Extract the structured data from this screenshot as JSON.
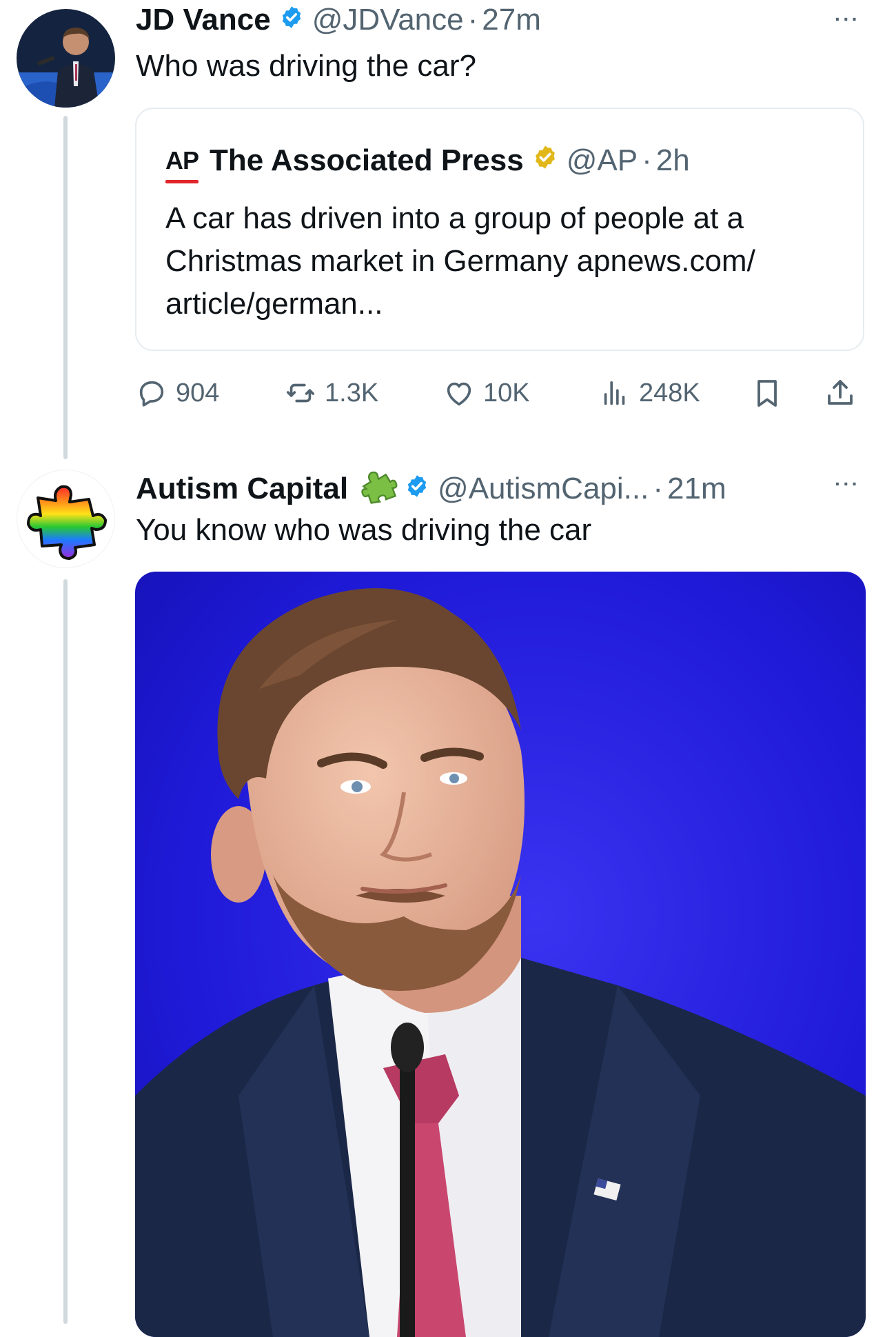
{
  "tweet1": {
    "name": "JD Vance",
    "handle": "@JDVance",
    "separator": "·",
    "time": "27m",
    "text": "Who was driving the car?",
    "more": "···",
    "quote": {
      "logo": "AP",
      "name": "The Associated Press",
      "handle": "@AP",
      "separator": "·",
      "time": "2h",
      "text": "A car has driven into a group of people at a Christmas market in Germany apnews.com/ article/german..."
    },
    "actions": {
      "replies": "904",
      "reposts": "1.3K",
      "likes": "10K",
      "views": "248K"
    }
  },
  "tweet2": {
    "name": "Autism Capital",
    "handle": "@AutismCapi...",
    "separator": "·",
    "time": "21m",
    "text": "You know who was driving the car",
    "more": "···"
  },
  "icons": {
    "verified_blue": "verified-badge-icon",
    "verified_gold": "verified-org-badge-icon",
    "name_emoji": "puzzle-piece-icon"
  },
  "colors": {
    "verified_blue": "#1d9bf0",
    "verified_gold": "#e2b719",
    "secondary_text": "#536471",
    "ap_red": "#e0262b",
    "photo_background": "#1d17d8"
  }
}
